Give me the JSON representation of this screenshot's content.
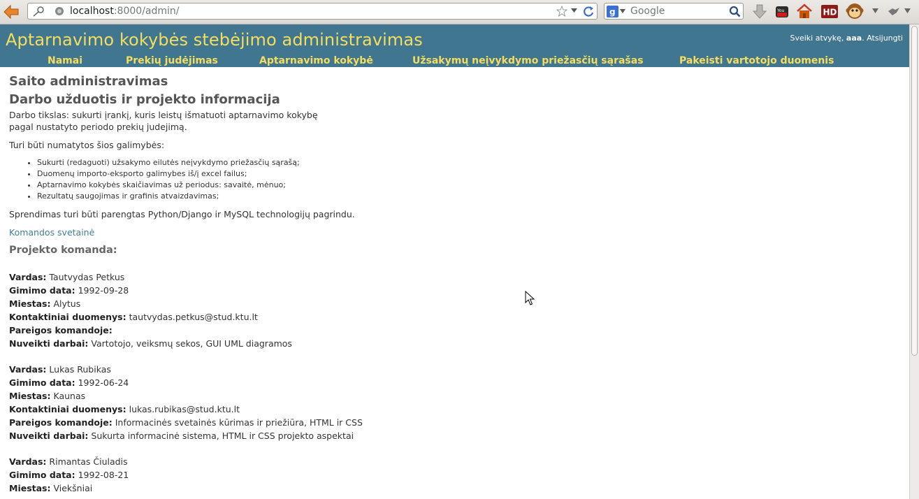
{
  "browser": {
    "url_host": "localhost",
    "url_rest": ":8000/admin/",
    "search_placeholder": "Google",
    "hd_label": "HD"
  },
  "header": {
    "title": "Aptarnavimo kokybės stebėjimo administravimas",
    "welcome": "Sveiki atvykę,",
    "username": "aaa",
    "logout": "Atsijungti"
  },
  "nav": {
    "items": [
      {
        "label": "Namai"
      },
      {
        "label": "Prekių judėjimas"
      },
      {
        "label": "Aptarnavimo kokybė"
      },
      {
        "label": "Užsakymų neįvykdymo priežasčių sąrašas"
      },
      {
        "label": "Pakeisti vartotojo duomenis"
      }
    ]
  },
  "content": {
    "heading": "Saito administravimas",
    "subheading": "Darbo užduotis ir projekto informacija",
    "intro": "Darbo tikslas: sukurti įrankį, kuris leistų išmatuoti aptarnavimo kokybę pagal nustatyto periodo prekių judejimą.",
    "features_intro": "Turi būti numatytos šios galimybės:",
    "features": [
      "Sukurti (redaguoti) užsakymo eilutės neįvykdymo priežasčių sąrašą;",
      "Duomenų importo-eksporto galimybes iš/į excel failus;",
      "Aptarnavimo kokybės skaičiavimas už periodus: savaitė, mėnuo;",
      "Rezultatų saugojimas ir grafinis atvaizdavimas;"
    ],
    "solution": "Sprendimas turi būti parengtas Python/Django ir MySQL technologijų pagrindu.",
    "team_link": "Komandos svetainė",
    "team_title": "Projekto komanda:",
    "labels": {
      "name": "Vardas:",
      "birth": "Gimimo data:",
      "city": "Miestas:",
      "contact": "Kontaktiniai duomenys:",
      "duties": "Pareigos komandoje:",
      "done": "Nuveikti darbai:"
    },
    "members": [
      {
        "name": "Tautvydas Petkus",
        "birth": "1992-09-28",
        "city": "Alytus",
        "contact": "tautvydas.petkus@stud.ktu.lt",
        "duties": "",
        "done": "Vartotojo, veiksmų sekos, GUI UML diagramos"
      },
      {
        "name": "Lukas Rubikas",
        "birth": "1992-06-24",
        "city": "Kaunas",
        "contact": "lukas.rubikas@stud.ktu.lt",
        "duties": "Informacinės svetainės kūrimas ir priežiūra, HTML ir CSS",
        "done": "Sukurta informacinė sistema, HTML ir CSS projekto aspektai"
      },
      {
        "name": "Rimantas Čiuladis",
        "birth": "1992-08-21",
        "city": "Viekšniai"
      }
    ]
  },
  "colors": {
    "header_bg": "#417690",
    "header_accent": "#f5dd5d",
    "link": "#447e9b"
  }
}
